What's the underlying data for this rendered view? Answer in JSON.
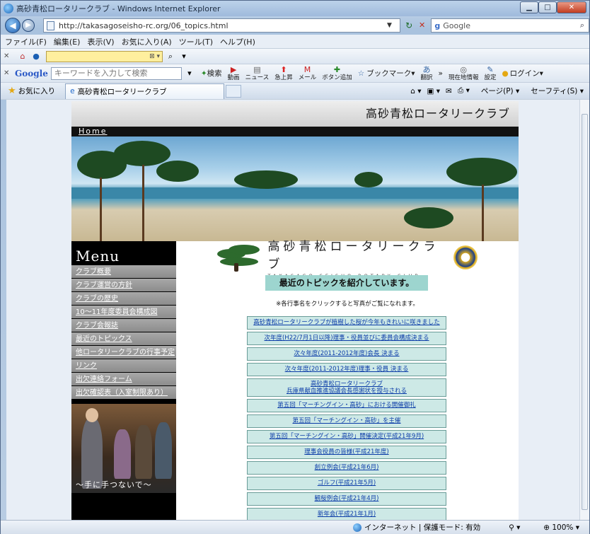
{
  "window": {
    "title": "高砂青松ロータリークラブ - Windows Internet Explorer",
    "min": "▁",
    "max": "□",
    "close": "✕"
  },
  "address": {
    "url": "http://takasagoseisho-rc.org/06_topics.html",
    "google_label": "Google"
  },
  "menubar": [
    "ファイル(F)",
    "編集(E)",
    "表示(V)",
    "お気に入り(A)",
    "ツール(T)",
    "ヘルプ(H)"
  ],
  "google_toolbar": {
    "logo": "Google",
    "placeholder": "キーワードを入力して検索",
    "search_label": "検索",
    "buttons": [
      "動画",
      "ニュース",
      "急上昇",
      "メール",
      "ボタン追加"
    ],
    "bookmarks": "ブックマーク",
    "translate": "翻訳",
    "location": "現在地情報",
    "settings": "設定",
    "login": "ログイン"
  },
  "favbar": {
    "favorites": "お気に入り",
    "tab_title": "高砂青松ロータリークラブ",
    "page_menu": "ページ(P)",
    "safety_menu": "セーフティ(S)"
  },
  "site": {
    "header_title": "高砂青松ロータリークラブ",
    "home_link": "Home",
    "menu_heading": "Menu",
    "menu_items": [
      "クラブ概要",
      "クラブ運営の方針",
      "クラブの歴史",
      "10〜11年度委員会構成図",
      "クラブ会報誌",
      "最近のトピックス",
      "他ロータリークラブの行事予定",
      "リンク",
      "出欠連絡フォーム",
      "出欠確認表（入室制限あり）"
    ],
    "photo_caption": "〜手に手つないで〜",
    "logo_jp": "高砂青松ロータリークラブ",
    "logo_en": "TAKASAGO SEISHO ROTARY CLUB",
    "topic_heading": "最近のトピックを紹介しています。",
    "note": "※各行事名をクリックすると写真がご覧になれます。",
    "topics": [
      "高砂青松ロータリークラブが植樹した桜が今年もきれいに咲きました",
      "次年度(H22/7月1日以降)理事・役員並びに委員会構成決まる",
      "次々年度(2011-2012年度)会長 決まる",
      "次々年度(2011-2012年度)理事・役員 決まる",
      "高砂青松ロータリークラブ\n兵庫県献血推進協議会長感謝状を授与される",
      "第五回「マーチングイン・高砂」における開催御礼",
      "第五回「マーチングイン・高砂」を主催",
      "第五回「マーチングイン・高砂」開催決定(平成21年9月)",
      "理事会役員の皆様(平成21年度)",
      "創立例会(平成21年6月)",
      "ゴルフ(平成21年5月)",
      "観桜例会(平成21年4月)",
      "新年会(平成21年1月)"
    ]
  },
  "status": {
    "zone": "インターネット | 保護モード: 有効",
    "zoom": "100%"
  }
}
